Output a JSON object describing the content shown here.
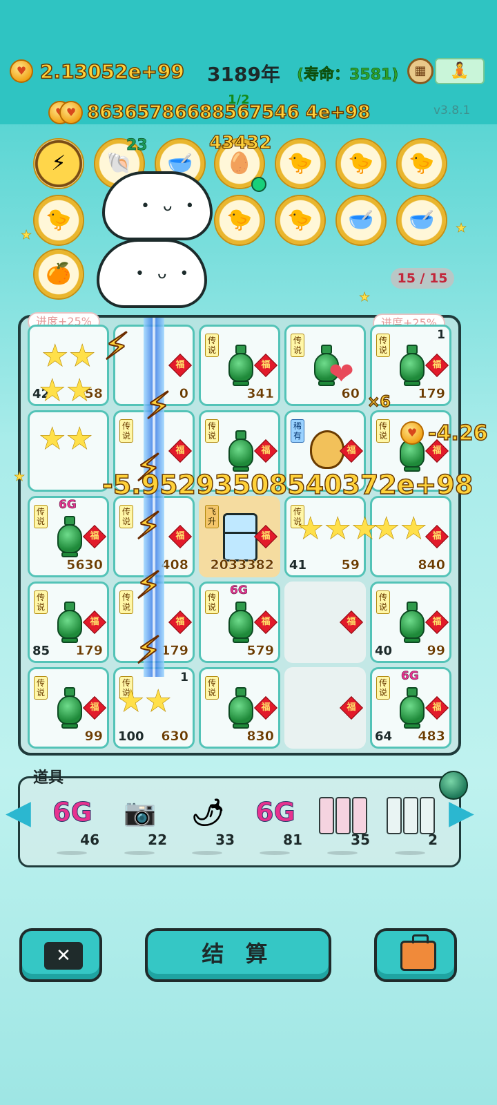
{
  "header": {
    "main_coins": "2.13052e+99",
    "year": "3189年",
    "lifespan": "(寿命：3581)",
    "sub_coins": "86365786688567546 4e+98",
    "page_indicator": "1/2",
    "version": "v3.8.1"
  },
  "buffs": {
    "shell_count": "23",
    "egg_tray_count": "43432",
    "counter": "15 / 15"
  },
  "board": {
    "progress_left": "进度+25%",
    "progress_right": "进度+25%",
    "floating_big": "-5.95293508540372e+98",
    "floating_small": "-4.26",
    "multiplier": "×6",
    "rarity_legend": "传说",
    "rarity_rare": "稀有",
    "rarity_fly": "飞升",
    "fu": "福",
    "six_g": "6G",
    "cells": [
      {
        "left": "42",
        "val": "58"
      },
      {
        "val": "0"
      },
      {
        "val": "341"
      },
      {
        "val": "60"
      },
      {
        "top": "1",
        "val": "179"
      },
      {
        "val": ""
      },
      {
        "val": "57"
      },
      {
        "val": ""
      },
      {
        "val": ""
      },
      {
        "val": ""
      },
      {
        "val": "5630"
      },
      {
        "val": "408"
      },
      {
        "val": "2033382"
      },
      {
        "left": "41",
        "val": "59"
      },
      {
        "val": "840"
      },
      {
        "left": "85",
        "val": "179"
      },
      {
        "val": "179"
      },
      {
        "val": "579"
      },
      {
        "val": ""
      },
      {
        "left": "40",
        "val": "99"
      },
      {
        "val": "99"
      },
      {
        "left": "100",
        "top": "1",
        "val": "630"
      },
      {
        "val": "830"
      },
      {
        "val": ""
      },
      {
        "left": "64",
        "val": "483"
      }
    ]
  },
  "items": {
    "title": "道具",
    "list": [
      {
        "name": "6G",
        "qty": "46"
      },
      {
        "name": "camera",
        "qty": "22"
      },
      {
        "name": "pepper",
        "qty": "33"
      },
      {
        "name": "6G",
        "qty": "81"
      },
      {
        "name": "rare-cards",
        "qty": "35"
      },
      {
        "name": "legend-cards",
        "qty": "2"
      }
    ]
  },
  "footer": {
    "settle_label": "结 算"
  }
}
